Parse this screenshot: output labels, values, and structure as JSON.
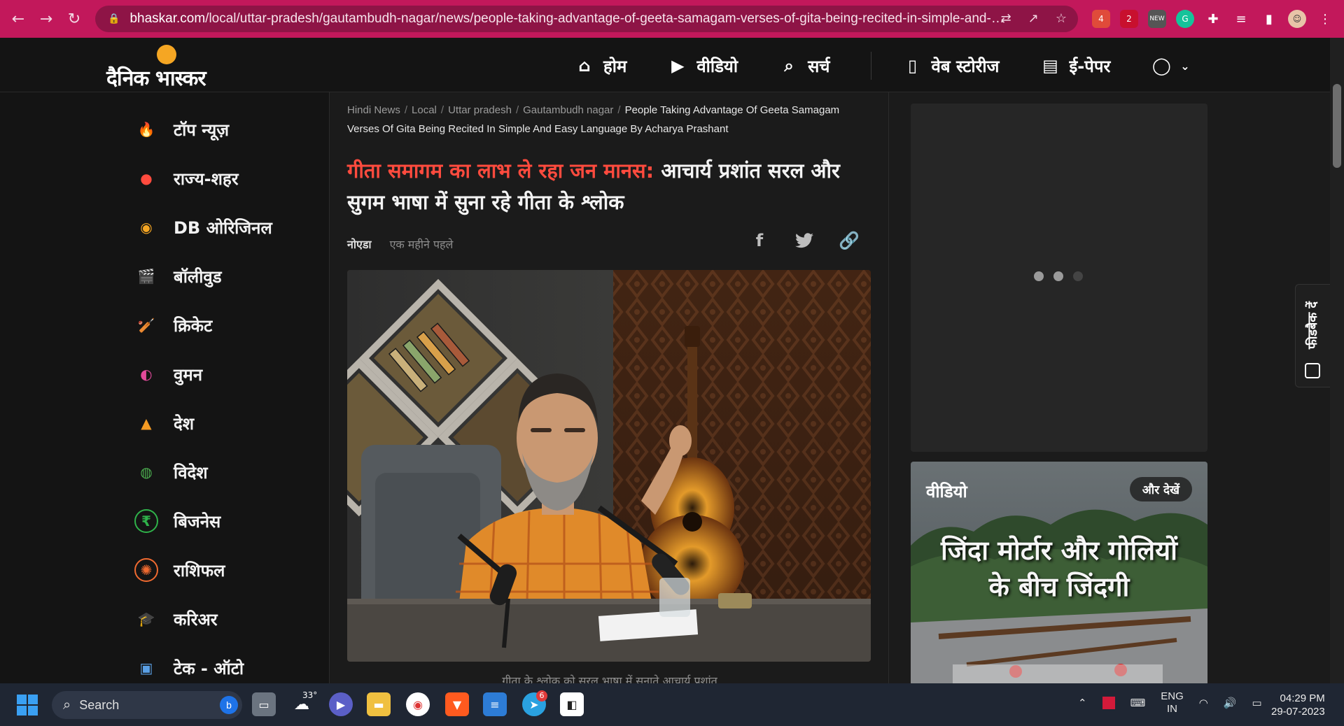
{
  "browser": {
    "url_host": "bhaskar.com",
    "url_path": "/local/uttar-pradesh/gautambudh-nagar/news/people-taking-advantage-of-geeta-samagam-verses-of-gita-being-recited-in-simple-and-easy-lan...",
    "back_icon": "←",
    "forward_icon": "→",
    "reload_icon": "↻",
    "ext_badges": [
      "4",
      "2",
      "NEW"
    ]
  },
  "site": {
    "logo_text": "दैनिक भास्कर",
    "nav": [
      {
        "label": "होम",
        "icon": "⌂"
      },
      {
        "label": "वीडियो",
        "icon": "▶"
      },
      {
        "label": "सर्च",
        "icon": "⌕"
      },
      {
        "label": "वेब स्टोरीज",
        "icon": "▯"
      },
      {
        "label": "ई-पेपर",
        "icon": "▤"
      }
    ]
  },
  "sidebar": {
    "items": [
      {
        "label": "टॉप न्यूज़",
        "icon": "🔥",
        "color": "#ff6a2b"
      },
      {
        "label": "राज्य-शहर",
        "icon": "●",
        "color": "#ff4b3e"
      },
      {
        "label": "DB ओरिजिनल",
        "icon": "◉",
        "color": "#f5a623"
      },
      {
        "label": "बॉलीवुड",
        "icon": "🎬",
        "color": "#a070d8"
      },
      {
        "label": "क्रिकेट",
        "icon": "🏏",
        "color": "#3a7bd5"
      },
      {
        "label": "वुमन",
        "icon": "◐",
        "color": "#e24a9b"
      },
      {
        "label": "देश",
        "icon": "▲",
        "color": "#f59b23"
      },
      {
        "label": "विदेश",
        "icon": "◍",
        "color": "#4caf50"
      },
      {
        "label": "बिजनेस",
        "icon": "₹",
        "color": "#2fb24a"
      },
      {
        "label": "राशिफल",
        "icon": "✺",
        "color": "#f06a30"
      },
      {
        "label": "करिअर",
        "icon": "🎓",
        "color": "#f5a623"
      },
      {
        "label": "टेक - ऑटो",
        "icon": "▣",
        "color": "#5aa0e6"
      }
    ]
  },
  "article": {
    "breadcrumbs": [
      "Hindi News",
      "Local",
      "Uttar pradesh",
      "Gautambudh nagar"
    ],
    "breadcrumb_sep": "/",
    "breadcrumb_current": "People Taking Advantage Of Geeta Samagam Verses Of Gita Being Recited In Simple And Easy Language By Acharya Prashant",
    "headline_highlight": "गीता समागम का लाभ ले रहा जन मानस:",
    "headline_rest": " आचार्य प्रशांत सरल और सुगम भाषा में सुना रहे गीता के श्लोक",
    "city": "नोएडा",
    "time": "एक महीने पहले",
    "share_icons": [
      "f",
      "t",
      "🔗"
    ],
    "caption": "गीता के श्लोक को सरल भाषा में सुनाते आचार्य प्रशांत"
  },
  "right": {
    "video_title": "वीडियो",
    "more_label": "और देखें",
    "video_text_1": "जिंदा मोर्टार और गोलियों",
    "video_text_2": "के बीच जिंदगी"
  },
  "feedback_label": "फीडबैक दें",
  "taskbar": {
    "search_label": "Search",
    "weather": "33°",
    "telegram_badge": "6",
    "lang_1": "ENG",
    "lang_2": "IN",
    "time": "04:29 PM",
    "date": "29-07-2023"
  }
}
